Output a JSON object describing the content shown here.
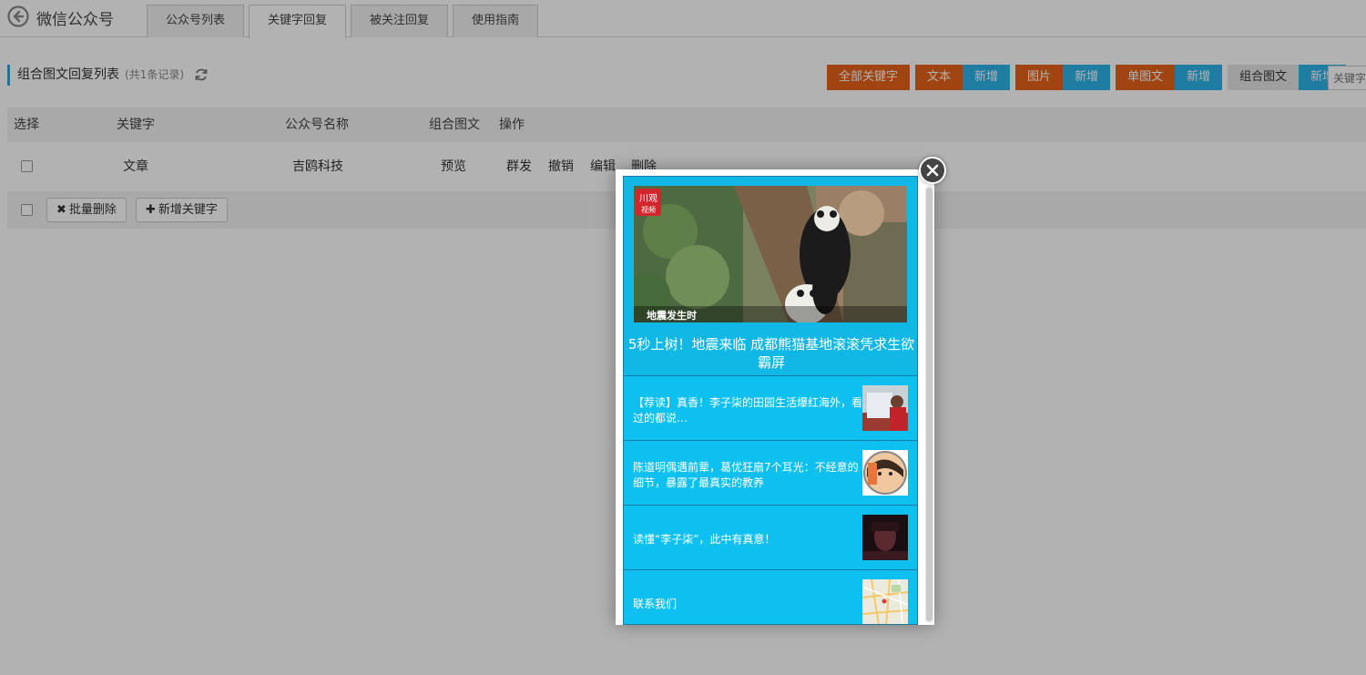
{
  "header": {
    "app_title": "微信公众号",
    "tabs": [
      {
        "label": "公众号列表"
      },
      {
        "label": "关键字回复"
      },
      {
        "label": "被关注回复"
      },
      {
        "label": "使用指南"
      }
    ]
  },
  "toolbar": {
    "list_title": "组合图文回复列表",
    "count_text": "(共1条记录)",
    "filters": {
      "all_keywords": "全部关键字",
      "text": "文本",
      "image": "图片",
      "single_news": "单图文",
      "multi_news": "组合图文",
      "add": "新增"
    },
    "keyword_placeholder": "关键字"
  },
  "table": {
    "headers": [
      "选择",
      "关键字",
      "公众号名称",
      "组合图文",
      "操作"
    ],
    "rows": [
      {
        "keyword": "文章",
        "account": "吉鸥科技",
        "preview": "预览",
        "actions": [
          "群发",
          "撤销",
          "编辑",
          "删除"
        ]
      }
    ],
    "footer": {
      "batch_delete": "批量删除",
      "add_keyword": "新增关键字",
      "batch_delete_icon": "✖",
      "add_keyword_icon": "✚"
    }
  },
  "preview_modal": {
    "lead_badge": "川观",
    "lead_badge_sub": "视频",
    "lead_overlay_text": "地震发生时",
    "lead_title": "5秒上树！地震来临 成都熊猫基地滚滚凭求生欲霸屏",
    "articles": [
      {
        "title": "【荐读】真香！李子柒的田园生活爆红海外，看过的都说…"
      },
      {
        "title": "陈道明偶遇前辈，葛优狂扇7个耳光：不经意的细节，暴露了最真实的教养"
      },
      {
        "title": "读懂“李子柒”，此中有真意！"
      },
      {
        "title": "联系我们"
      }
    ]
  },
  "colors": {
    "orange": "#e6641a",
    "blue": "#2db4e8",
    "modal_bg": "#0ec0ef"
  }
}
